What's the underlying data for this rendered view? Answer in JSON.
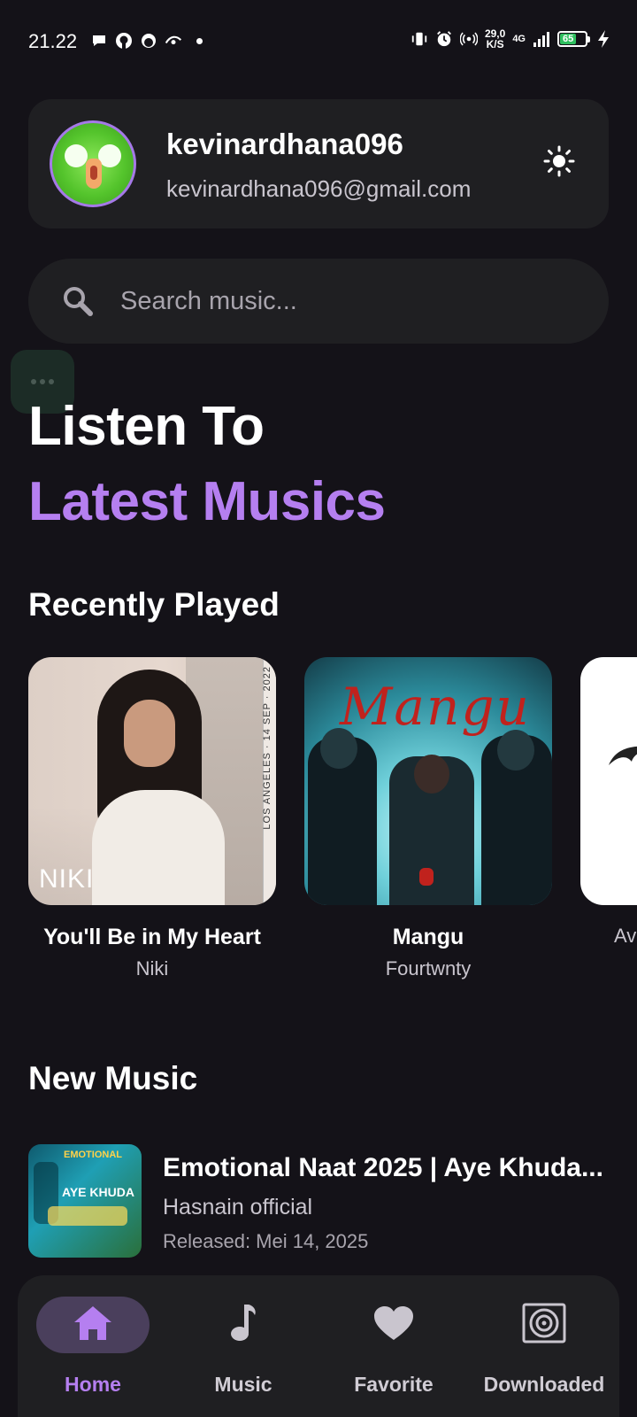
{
  "status_bar": {
    "time": "21.22",
    "net_speed_value": "29,0",
    "net_speed_unit": "K/S",
    "network_type": "4G",
    "battery_level": "65"
  },
  "profile": {
    "username": "kevinardhana096",
    "email": "kevinardhana096@gmail.com"
  },
  "search": {
    "placeholder": "Search music..."
  },
  "hero": {
    "line1": "Listen To",
    "line2": "Latest Musics"
  },
  "recently_played": {
    "title": "Recently Played",
    "items": [
      {
        "title": "You'll Be in My Heart",
        "artist": "Niki",
        "art_label": "NIKI",
        "art_side_text": "LOS ANGELES · 14 SEP · 2022"
      },
      {
        "title": "Mangu",
        "artist": "Fourtwnty",
        "art_label": "Mangu"
      },
      {
        "title": "",
        "artist": "Av"
      }
    ]
  },
  "new_music": {
    "title": "New Music",
    "items": [
      {
        "title": "Emotional Naat 2025 | Aye Khuda...",
        "artist": "Hasnain official",
        "released": "Released: Mei 14, 2025",
        "art_text_1": "EMOTIONAL",
        "art_text_2": "AYE KHUDA"
      }
    ]
  },
  "bottom_nav": {
    "items": [
      {
        "label": "Home",
        "icon": "home-icon"
      },
      {
        "label": "Music",
        "icon": "music-note-icon"
      },
      {
        "label": "Favorite",
        "icon": "heart-icon"
      },
      {
        "label": "Downloaded",
        "icon": "disc-icon"
      }
    ],
    "active": "Home"
  },
  "colors": {
    "background": "#141218",
    "surface": "#1f1f22",
    "accent": "#b57ff0",
    "nav_active_bg": "#4a3f5c"
  }
}
